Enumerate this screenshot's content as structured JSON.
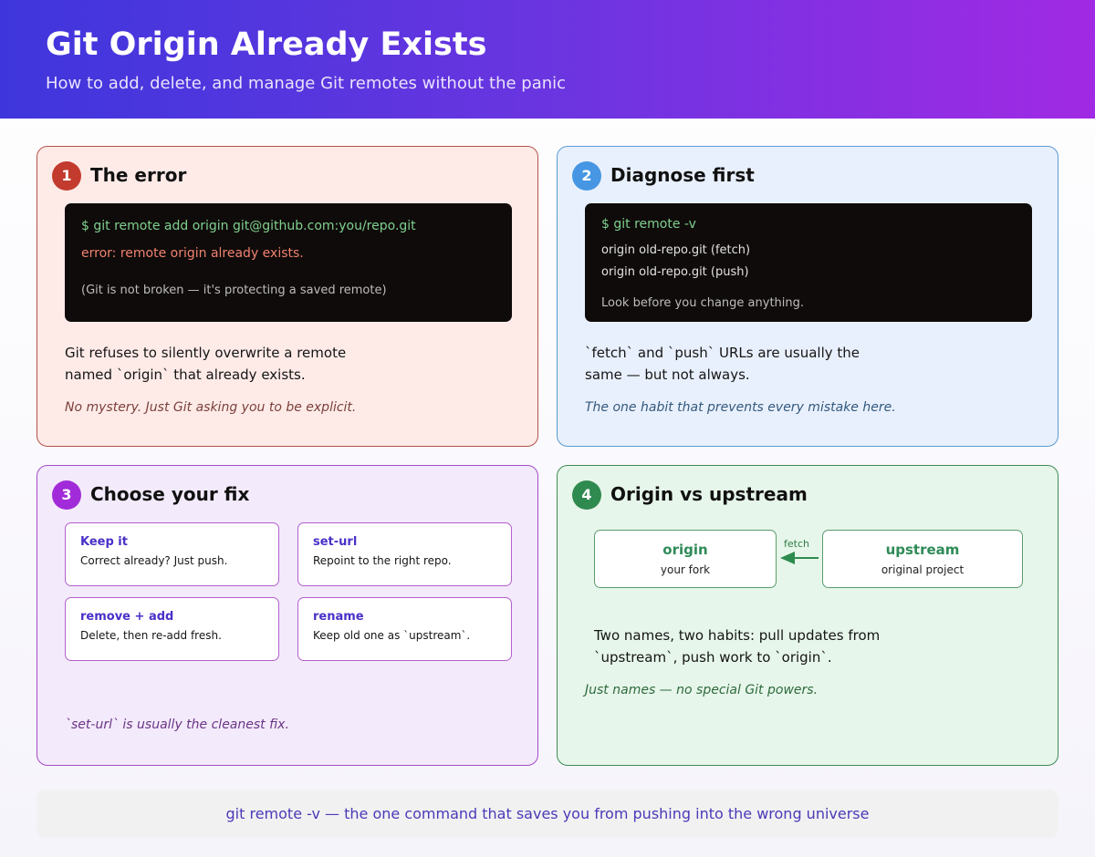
{
  "header": {
    "title": "Git Origin Already Exists",
    "subtitle": "How to add, delete, and manage Git remotes without the panic"
  },
  "cards": [
    {
      "number": "1",
      "title": "The error",
      "terminal": {
        "command": "$ git remote add origin git@github.com:you/repo.git",
        "error": "error: remote origin already exists.",
        "note": "(Git is not broken — it's protecting a saved remote)"
      },
      "body": "Git refuses to silently overwrite a remote named `origin` that already exists.",
      "note": "No mystery. Just Git asking you to be explicit."
    },
    {
      "number": "2",
      "title": "Diagnose first",
      "terminal": {
        "command": "$ git remote -v",
        "output": [
          "origin old-repo.git (fetch)",
          "origin old-repo.git (push)"
        ],
        "note": "Look before you change anything."
      },
      "body": "`fetch` and `push` URLs are usually the same — but not always.",
      "note": "The one habit that prevents every mistake here."
    },
    {
      "number": "3",
      "title": "Choose your fix",
      "fixes": [
        {
          "title": "Keep it",
          "desc": "Correct already? Just push."
        },
        {
          "title": "set-url",
          "desc": "Repoint to the right repo."
        },
        {
          "title": "remove + add",
          "desc": "Delete, then re-add fresh."
        },
        {
          "title": "rename",
          "desc": "Keep old one as `upstream`."
        }
      ],
      "note": "`set-url` is usually the cleanest fix."
    },
    {
      "number": "4",
      "title": "Origin vs upstream",
      "diagram": {
        "left": {
          "title": "origin",
          "sub": "your fork"
        },
        "right": {
          "title": "upstream",
          "sub": "original project"
        },
        "arrow_label": "fetch"
      },
      "body": "Two names, two habits: pull updates from `upstream`, push work to `origin`.",
      "note": "Just names — no special Git powers."
    }
  ],
  "footer": "git remote -v — the one command that saves you from pushing into the wrong universe",
  "colors": {
    "header_start": "#3e36dc",
    "header_end": "#a12ae4",
    "card1_accent": "#c33b2e",
    "card2_accent": "#4696e3",
    "card3_accent": "#a12bd8",
    "card4_accent": "#2f8a4f",
    "footer_text": "#4a3ab6"
  }
}
